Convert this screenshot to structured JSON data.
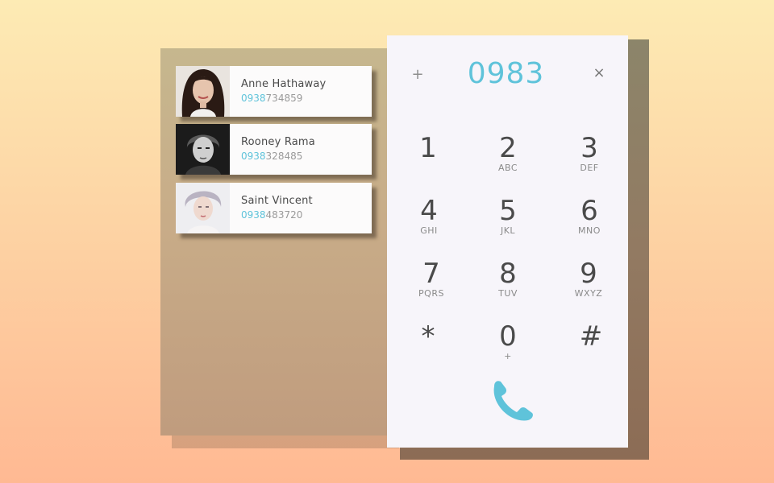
{
  "contacts": [
    {
      "name": "Anne Hathaway",
      "number_match": "0938",
      "number_rest": "734859",
      "avatar": "portrait-photo-color"
    },
    {
      "name": "Rooney Rama",
      "number_match": "0938",
      "number_rest": "328485",
      "avatar": "portrait-photo-bw"
    },
    {
      "name": "Saint Vincent",
      "number_match": "0938",
      "number_rest": "483720",
      "avatar": "portrait-photo-light"
    }
  ],
  "dialer": {
    "add_icon": "+",
    "entered_number": "0983",
    "clear_icon": "×",
    "keys": [
      {
        "digit": "1",
        "letters": ""
      },
      {
        "digit": "2",
        "letters": "ABC"
      },
      {
        "digit": "3",
        "letters": "DEF"
      },
      {
        "digit": "4",
        "letters": "GHI"
      },
      {
        "digit": "5",
        "letters": "JKL"
      },
      {
        "digit": "6",
        "letters": "MNO"
      },
      {
        "digit": "7",
        "letters": "PQRS"
      },
      {
        "digit": "8",
        "letters": "TUV"
      },
      {
        "digit": "9",
        "letters": "WXYZ"
      },
      {
        "digit": "*",
        "letters": ""
      },
      {
        "digit": "0",
        "letters": "+"
      },
      {
        "digit": "#",
        "letters": ""
      }
    ],
    "call_icon": "phone-icon"
  },
  "colors": {
    "accent": "#5fc3da",
    "text": "#4a4a4a",
    "muted": "#8a8a8a"
  }
}
